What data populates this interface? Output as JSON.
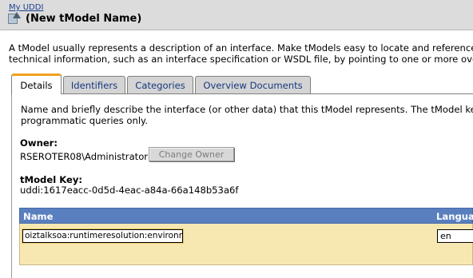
{
  "breadcrumb": "My UDDI",
  "title": "(New tModel Name)",
  "icon": "tmodel-icon",
  "intro_lines": [
    "A tModel usually represents a description of an interface. Make tModels easy to locate and reference",
    "technical information, such as an interface specification or WSDL file, by pointing to one or more over"
  ],
  "tabs": [
    {
      "label": "Details",
      "active": true
    },
    {
      "label": "Identifiers",
      "active": false
    },
    {
      "label": "Categories",
      "active": false
    },
    {
      "label": "Overview Documents",
      "active": false
    }
  ],
  "details": {
    "description_lines": [
      "Name and briefly describe the interface (or other data) that this tModel represents. The tModel key",
      "programmatic queries only."
    ],
    "owner_label": "Owner:",
    "owner_value": "RSEROTER08\\Administrator",
    "change_owner_label": "Change Owner",
    "key_label": "tModel Key:",
    "key_value": "uddi:1617eacc-0d5d-4eac-a84a-66a148b53a6f"
  },
  "name_table": {
    "headers": {
      "name": "Name",
      "language": "Langua"
    },
    "row": {
      "name_value": "oiztalksoa:runtimeresolution:environment",
      "language_value": "en"
    }
  },
  "colors": {
    "header_bg": "#dcdcdc",
    "link": "#1b3f8f",
    "tab_accent": "#f0a020",
    "table_header": "#5a7fbf",
    "table_row": "#f7e8b2"
  }
}
